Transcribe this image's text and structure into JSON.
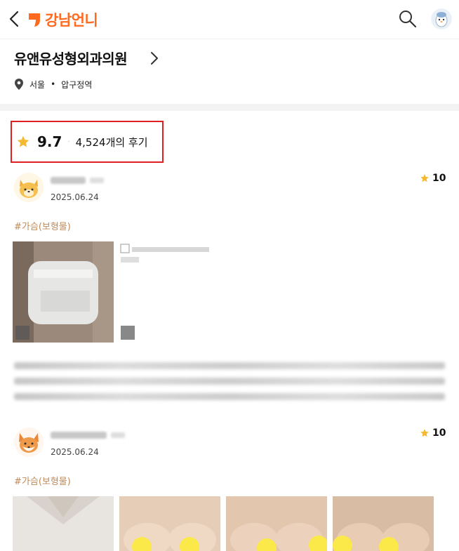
{
  "header": {
    "logo_text": "강남언니",
    "brand_color": "#ff6a1f",
    "icons": [
      "chevron-left-icon",
      "search-icon",
      "profile-avatar"
    ]
  },
  "clinic": {
    "name": "유앤유성형외과의원",
    "city": "서울",
    "separator": "•",
    "station": "압구정역"
  },
  "rating": {
    "score": "9.7",
    "review_count": "4,524개의 후기",
    "star_color": "#f5b82e",
    "highlight_color": "#e02020"
  },
  "reviews": [
    {
      "date": "2025.06.24",
      "score": "10",
      "tag": "#가슴(보형물)"
    },
    {
      "date": "2025.06.24",
      "score": "10",
      "tag": "#가슴(보형물)"
    }
  ]
}
